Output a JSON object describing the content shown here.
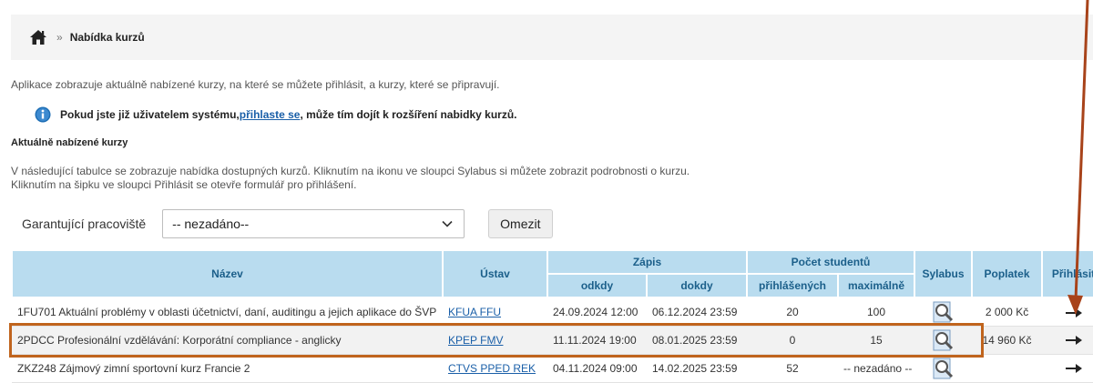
{
  "breadcrumb": {
    "separator": "»",
    "current": "Nabídka kurzů"
  },
  "intro": "Aplikace zobrazuje aktuálně nabízené kurzy, na které se můžete přihlásit, a kurzy, které se připravují.",
  "info": {
    "before": "Pokud jste již uživatelem systému, ",
    "link": "přihlaste se",
    "after": ", může tím dojít k rozšíření nabidky kurzů."
  },
  "section_title": "Aktuálně nabízené kurzy",
  "description": "V následující tabulce se zobrazuje nabídka dostupných kurzů. Kliknutím na ikonu ve sloupci Sylabus si můžete zobrazit podrobnosti o kurzu. Kliknutím na šipku ve sloupci Přihlásit se otevře formulář pro přihlášení.",
  "filter": {
    "label": "Garantující pracoviště",
    "selected": "-- nezadáno--",
    "button": "Omezit"
  },
  "table": {
    "headers": {
      "name": "Název",
      "unit": "Ústav",
      "enrollment": "Zápis",
      "from": "odkdy",
      "to": "dokdy",
      "students": "Počet studentů",
      "registered": "přihlášených",
      "maximum": "maximálně",
      "syllabus": "Sylabus",
      "fee": "Poplatek",
      "signup": "Přihlásit"
    },
    "rows": [
      {
        "name": "1FU701 Aktuální problémy v oblasti účetnictví, daní, auditingu a jejich aplikace do ŠVP",
        "unit": "KFUA FFU",
        "from": "24.09.2024 12:00",
        "to": "06.12.2024 23:59",
        "registered": "20",
        "maximum": "100",
        "fee": "2 000 Kč"
      },
      {
        "name": "2PDCC Profesionální vzdělávání: Korporátní compliance - anglicky",
        "unit": "KPEP FMV",
        "from": "11.11.2024 19:00",
        "to": "08.01.2025 23:59",
        "registered": "0",
        "maximum": "15",
        "fee": "14 960 Kč"
      },
      {
        "name": "ZKZ248 Zájmový zimní sportovní kurz Francie 2",
        "unit": "CTVS PPED REK",
        "from": "04.11.2024 09:00",
        "to": "14.02.2025 23:59",
        "registered": "52",
        "maximum": "-- nezadáno --",
        "fee": ""
      }
    ]
  },
  "colors": {
    "header_bg": "#b9dcef",
    "header_text": "#1b5f8a",
    "link": "#1a5fa8",
    "highlight": "#c0641d"
  }
}
